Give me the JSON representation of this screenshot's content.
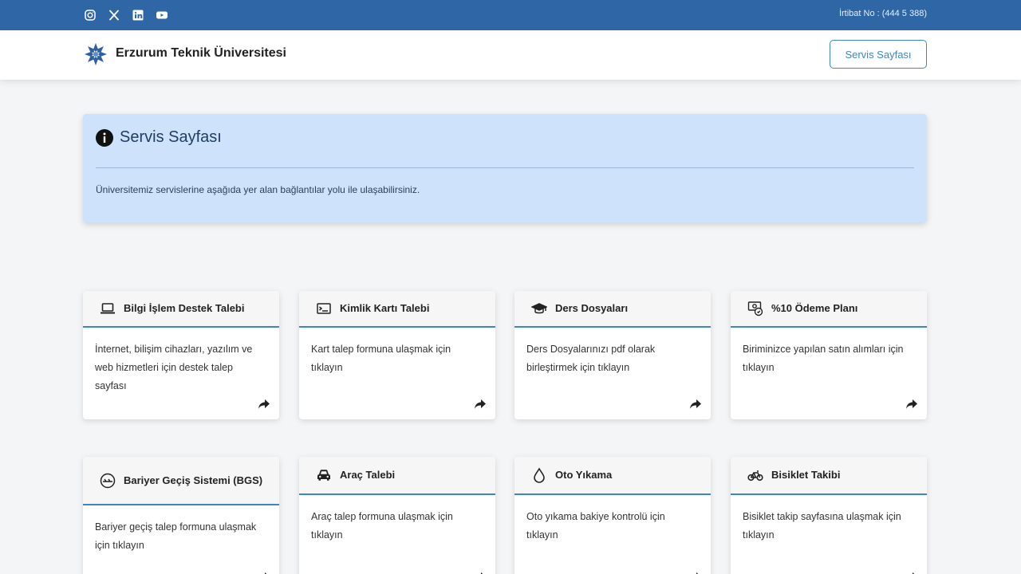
{
  "topbar": {
    "social": [
      {
        "icon": "instagram-icon"
      },
      {
        "icon": "x-twitter-icon"
      },
      {
        "icon": "linkedin-icon"
      },
      {
        "icon": "youtube-icon"
      }
    ],
    "hotline": "İrtibat No : (444 5 388)"
  },
  "header": {
    "brand": "Erzurum Teknik Üniversitesi",
    "service_button": "Servis Sayfası"
  },
  "alert": {
    "title": "Servis Sayfası",
    "description": "Üniversitemiz servislerine aşağıda yer alan bağlantılar yolu ile ulaşabilirsiniz."
  },
  "cards": [
    {
      "icon": "laptop-icon",
      "title": "Bilgi İşlem Destek Talebi",
      "text": "İnternet, bilişim cihazları, yazılım ve web hizmetleri için destek talep sayfası"
    },
    {
      "icon": "id-card-icon",
      "title": "Kimlik Kartı Talebi",
      "text": "Kart talep formuna ulaşmak için tıklayın"
    },
    {
      "icon": "graduation-cap-icon",
      "title": "Ders Dosyaları",
      "text": "Ders Dosyalarınızı pdf olarak birleştirmek için tıklayın"
    },
    {
      "icon": "payment-plan-icon",
      "title": "%10 Ödeme Planı",
      "text": "Biriminizce yapılan satın alımları için tıklayın"
    },
    {
      "icon": "barrier-gauge-icon",
      "title": "Bariyer Geçiş Sistemi (BGS)",
      "text": "Bariyer geçiş talep formuna ulaşmak için tıklayın"
    },
    {
      "icon": "car-icon",
      "title": "Araç Talebi",
      "text": "Araç talep formuna ulaşmak için tıklayın"
    },
    {
      "icon": "water-drop-icon",
      "title": "Oto Yıkama",
      "text": "Oto yıkama bakiye kontrolü için tıklayın"
    },
    {
      "icon": "bicycle-icon",
      "title": "Bisiklet Takibi",
      "text": "Bisiklet takip sayfasına ulaşmak için tıklayın"
    }
  ]
}
